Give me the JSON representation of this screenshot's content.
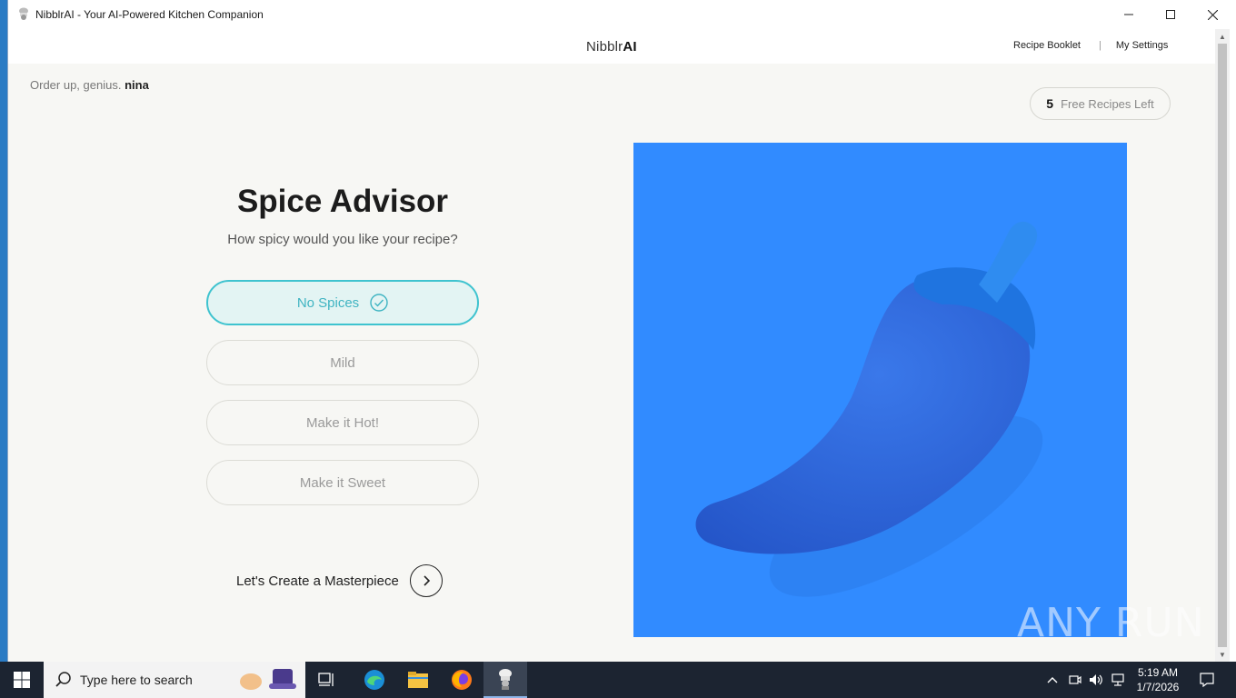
{
  "window": {
    "title": "NibblrAI - Your AI-Powered Kitchen Companion",
    "controls": {
      "minimize": "—",
      "maximize": "☐",
      "close": "✕"
    }
  },
  "nav": {
    "brand_prefix": "Nibblr",
    "brand_suffix": "AI",
    "links": [
      "Recipe Booklet",
      "My Settings"
    ],
    "separator": "|"
  },
  "greeting": {
    "text": "Order up, genius.",
    "user": "nina"
  },
  "credits": {
    "count": "5",
    "label": "Free Recipes Left"
  },
  "spice_advisor": {
    "title": "Spice Advisor",
    "subtitle": "How spicy would you like your recipe?",
    "options": [
      {
        "label": "No Spices",
        "selected": true
      },
      {
        "label": "Mild",
        "selected": false
      },
      {
        "label": "Make it Hot!",
        "selected": false
      },
      {
        "label": "Make it Sweet",
        "selected": false
      }
    ]
  },
  "cta": {
    "label": "Let's Create a Masterpiece"
  },
  "hero": {
    "icon": "chili-pepper-icon",
    "background": "#318bff",
    "pepper_color": "#2a63d6"
  },
  "watermark": "ANY RUN",
  "taskbar": {
    "search_placeholder": "Type here to search",
    "time": "5:19 AM",
    "date": "1/7/2026"
  },
  "colors": {
    "accent": "#3fc3cf",
    "selected_bg": "#e3f4f3",
    "page_bg": "#f7f7f4",
    "taskbar": "#1c2431"
  }
}
